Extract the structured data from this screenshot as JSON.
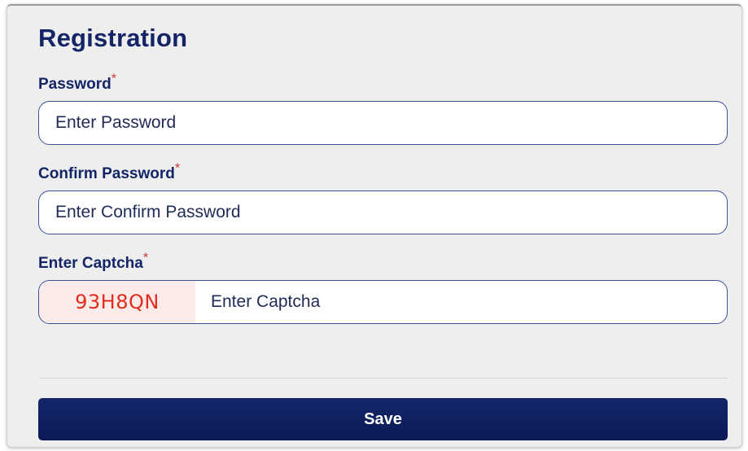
{
  "form": {
    "title": "Registration",
    "required_marker": "*",
    "password": {
      "label": "Password",
      "placeholder": "Enter Password",
      "value": ""
    },
    "confirm_password": {
      "label": "Confirm Password",
      "placeholder": "Enter Confirm Password",
      "value": ""
    },
    "captcha": {
      "label": "Enter Captcha",
      "code": "93H8QN",
      "placeholder": "Enter Captcha",
      "value": ""
    },
    "save_label": "Save"
  },
  "colors": {
    "heading": "#142567",
    "required": "#d0312d",
    "captcha_text": "#e52b1f",
    "button": "#0f2060",
    "panel": "#eeeeee"
  }
}
